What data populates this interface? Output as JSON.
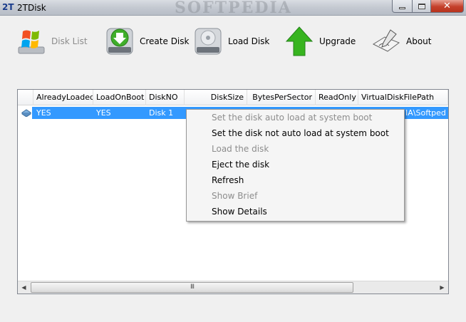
{
  "window": {
    "icon_text": "2T",
    "title": "2TDisk",
    "watermark": "SOFTPEDIA",
    "close_glyph": "✕"
  },
  "toolbar": {
    "items": [
      {
        "label": "Disk List",
        "icon": "windows-flag-icon",
        "enabled": false
      },
      {
        "label": "Create Disk",
        "icon": "disk-download-icon",
        "enabled": true
      },
      {
        "label": "Load Disk",
        "icon": "disk-drive-icon",
        "enabled": true
      },
      {
        "label": "Upgrade",
        "icon": "green-up-arrow-icon",
        "enabled": true
      },
      {
        "label": "About",
        "icon": "drawing-pen-icon",
        "enabled": true
      }
    ]
  },
  "list": {
    "columns": [
      "AlreadyLoaded",
      "LoadOnBoot",
      "DiskNO",
      "DiskSize",
      "BytesPerSector",
      "ReadOnly",
      "VirtualDiskFilePath"
    ],
    "rows": [
      {
        "AlreadyLoaded": "YES",
        "LoadOnBoot": "YES",
        "DiskNO": "Disk 1",
        "VirtualDiskFilePath": "IA\\Softped"
      }
    ],
    "scroll_grip": "III"
  },
  "context_menu": {
    "items": [
      {
        "label": "Set the disk auto load at system boot",
        "enabled": false
      },
      {
        "label": "Set the disk not auto load at system boot",
        "enabled": true
      },
      {
        "label": "Load the disk",
        "enabled": false
      },
      {
        "label": "Eject the disk",
        "enabled": true
      },
      {
        "label": "Refresh",
        "enabled": true
      },
      {
        "label": "Show Brief",
        "enabled": false
      },
      {
        "label": "Show Details",
        "enabled": true
      }
    ]
  },
  "colors": {
    "selection": "#3399ff",
    "disabled_text": "#8d8d8d",
    "close_button": "#c4402b"
  }
}
